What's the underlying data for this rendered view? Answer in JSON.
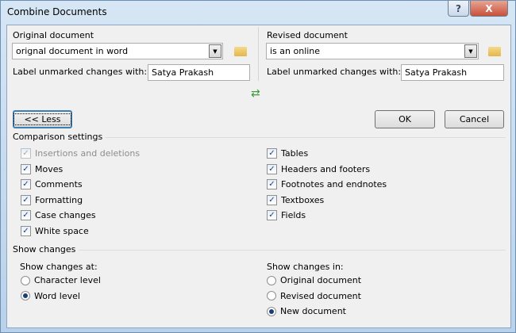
{
  "window": {
    "title": "Combine Documents",
    "help": "?",
    "close": "X"
  },
  "original": {
    "label": "Original document",
    "value": "orignal document in word",
    "label_changes": "Label unmarked changes with:",
    "label_value": "Satya Prakash"
  },
  "revised": {
    "label": "Revised document",
    "value": "is an online",
    "label_changes": "Label unmarked changes with:",
    "label_value": "Satya Prakash"
  },
  "buttons": {
    "less": "<< Less",
    "ok": "OK",
    "cancel": "Cancel"
  },
  "comparison": {
    "heading": "Comparison settings",
    "left": [
      {
        "label": "Insertions and deletions",
        "checked": true,
        "disabled": true
      },
      {
        "label": "Moves",
        "checked": true
      },
      {
        "label": "Comments",
        "checked": true
      },
      {
        "label": "Formatting",
        "checked": true
      },
      {
        "label": "Case changes",
        "checked": true
      },
      {
        "label": "White space",
        "checked": true
      }
    ],
    "right": [
      {
        "label": "Tables",
        "checked": true
      },
      {
        "label": "Headers and footers",
        "checked": true
      },
      {
        "label": "Footnotes and endnotes",
        "checked": true
      },
      {
        "label": "Textboxes",
        "checked": true
      },
      {
        "label": "Fields",
        "checked": true
      }
    ]
  },
  "show": {
    "heading": "Show changes",
    "at_label": "Show changes at:",
    "at": [
      {
        "label": "Character level",
        "selected": false
      },
      {
        "label": "Word level",
        "selected": true
      }
    ],
    "in_label": "Show changes in:",
    "in": [
      {
        "label": "Original document",
        "selected": false
      },
      {
        "label": "Revised document",
        "selected": false
      },
      {
        "label": "New document",
        "selected": true
      }
    ]
  }
}
